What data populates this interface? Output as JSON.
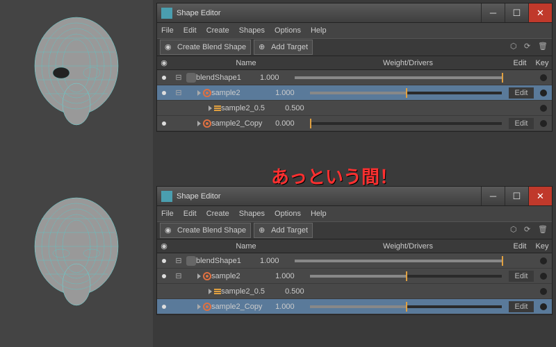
{
  "callout_text": "あっという間！",
  "windows": [
    {
      "title": "Shape Editor",
      "rows": [
        {
          "indent": 0,
          "icon": "bs",
          "name": "blendShape1",
          "value": "1.000",
          "fill": 100,
          "handle": 100,
          "vis": true,
          "edit": false,
          "tree": "⊟"
        },
        {
          "indent": 1,
          "icon": "target",
          "name": "sample2",
          "value": "1.000",
          "fill": 50,
          "handle": 50,
          "vis": true,
          "edit": true,
          "tree": "⊟",
          "selected": true
        },
        {
          "indent": 2,
          "icon": "bars",
          "name": "sample2_0.5",
          "value": "0.500",
          "fill": null,
          "vis": false,
          "edit": false
        },
        {
          "indent": 1,
          "icon": "target",
          "name": "sample2_Copy",
          "value": "0.000",
          "fill": 0,
          "handle": 0,
          "vis": true,
          "edit": true
        }
      ]
    },
    {
      "title": "Shape Editor",
      "rows": [
        {
          "indent": 0,
          "icon": "bs",
          "name": "blendShape1",
          "value": "1.000",
          "fill": 100,
          "handle": 100,
          "vis": true,
          "edit": false,
          "tree": "⊟"
        },
        {
          "indent": 1,
          "icon": "target",
          "name": "sample2",
          "value": "1.000",
          "fill": 50,
          "handle": 50,
          "vis": true,
          "edit": true,
          "tree": "⊟"
        },
        {
          "indent": 2,
          "icon": "bars",
          "name": "sample2_0.5",
          "value": "0.500",
          "fill": null,
          "vis": false,
          "edit": false
        },
        {
          "indent": 1,
          "icon": "target",
          "name": "sample2_Copy",
          "value": "1.000",
          "fill": 50,
          "handle": 50,
          "vis": true,
          "edit": true,
          "selected": true
        }
      ]
    }
  ],
  "menu": {
    "file": "File",
    "edit": "Edit",
    "create": "Create",
    "shapes": "Shapes",
    "options": "Options",
    "help": "Help"
  },
  "toolbar": {
    "create_blend": "Create Blend Shape",
    "add_target": "Add Target"
  },
  "header": {
    "vis": "◉",
    "name": "Name",
    "wd": "Weight/Drivers",
    "edit": "Edit",
    "key": "Key"
  },
  "edit_label": "Edit"
}
